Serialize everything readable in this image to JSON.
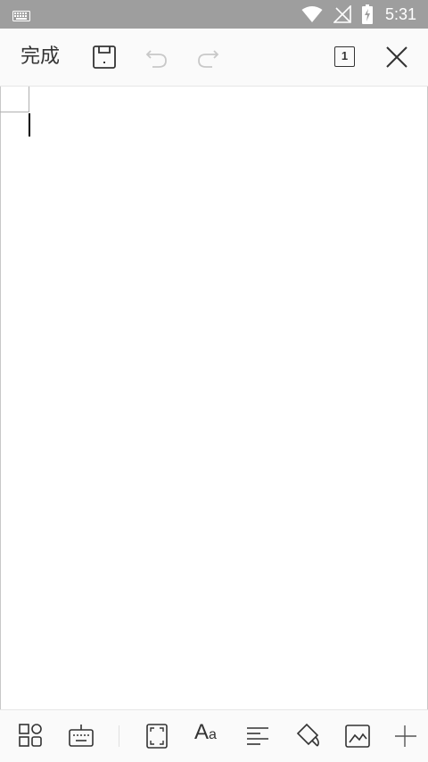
{
  "status_bar": {
    "time": "5:31",
    "icons": [
      "keyboard-icon",
      "wifi-icon",
      "no-signal-icon",
      "battery-charging-icon"
    ]
  },
  "toolbar": {
    "done_label": "完成",
    "page_number": "1",
    "icons": [
      "save-icon",
      "undo-icon",
      "redo-icon",
      "page-count-icon",
      "close-icon"
    ]
  },
  "bottom_toolbar": {
    "icons": [
      "apps-icon",
      "keyboard-toggle-icon",
      "fullscreen-icon",
      "font-icon",
      "align-icon",
      "paint-icon",
      "image-icon",
      "add-icon"
    ],
    "font_glyph_big": "A",
    "font_glyph_small": "a"
  }
}
